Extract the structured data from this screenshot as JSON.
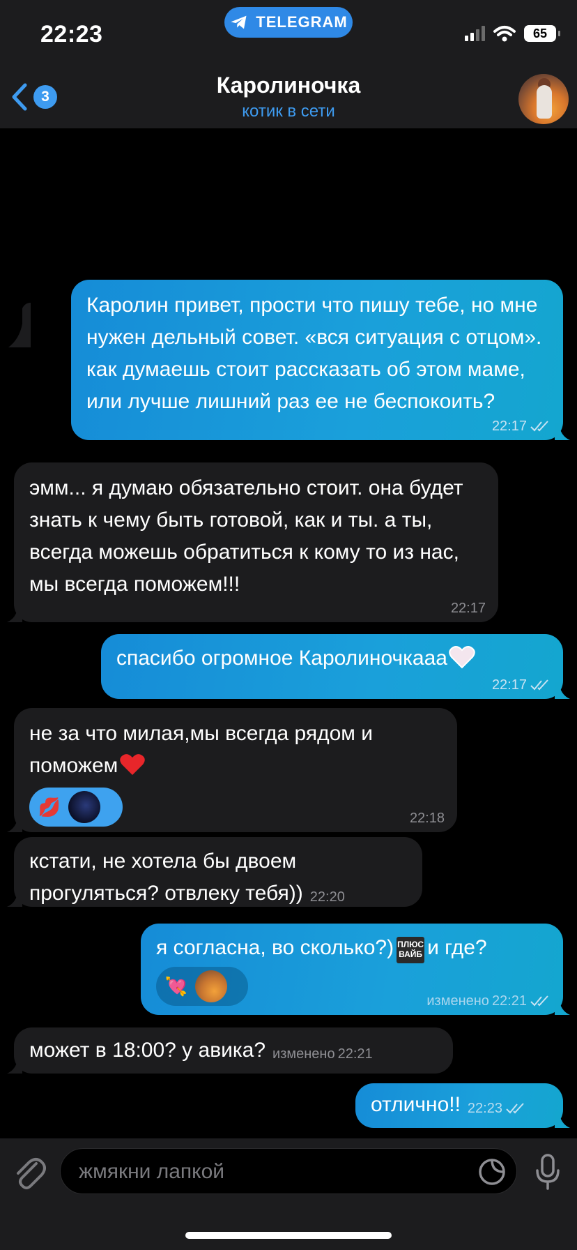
{
  "status_bar": {
    "time": "22:23",
    "pill_label": "TELEGRAM",
    "battery": "65"
  },
  "header": {
    "back_badge": "3",
    "title": "Каролиночка",
    "subtitle": "котик в сети"
  },
  "messages": [
    {
      "dir": "out",
      "text": "Каролин привет, прости что пишу тебе, но мне нужен дельный совет. «вся ситуация с отцом». как думаешь стоит рассказать об этом маме, или лучше лишний раз ее не беспокоить?",
      "time": "22:17",
      "read": true
    },
    {
      "dir": "in",
      "text": "эмм... я думаю обязательно стоит. она будет знать к чему быть готовой, как и ты. а ты, всегда можешь обратиться к кому то из нас, мы всегда поможем!!!",
      "time": "22:17"
    },
    {
      "dir": "out",
      "text": "спасибо огромное Каролиночкааа",
      "emoji": "heart-white-icon",
      "time": "22:17",
      "read": true
    },
    {
      "dir": "in",
      "text": "не за что милая,мы всегда рядом и поможем",
      "emoji": "red-heart-icon",
      "reactions": [
        "kiss-mark-icon",
        "avatar-moon"
      ],
      "time": "22:18"
    },
    {
      "dir": "in",
      "text": "кстати, не хотела бы двоем прогуляться? отвлеку тебя))",
      "time": "22:20"
    },
    {
      "dir": "out",
      "text_a": "я согласна, во сколько?)",
      "sticker_text": "ПЛЮС ВАЙБ",
      "text_b": "и где?",
      "reactions": [
        "heart-arrow-icon",
        "avatar-user"
      ],
      "edited_label": "изменено",
      "time": "22:21",
      "read": true
    },
    {
      "dir": "in",
      "text": "может в 18:00? у авика?",
      "edited_label": "изменено",
      "time": "22:21"
    },
    {
      "dir": "out",
      "text": "отлично!!",
      "time": "22:23",
      "read": true
    }
  ],
  "composer": {
    "placeholder": "жмякни лапкой"
  },
  "colors": {
    "accent": "#3e9bf0",
    "incoming_bubble": "#1c1c1e",
    "outgoing_bubble": "#168cd7",
    "background": "#000000"
  }
}
